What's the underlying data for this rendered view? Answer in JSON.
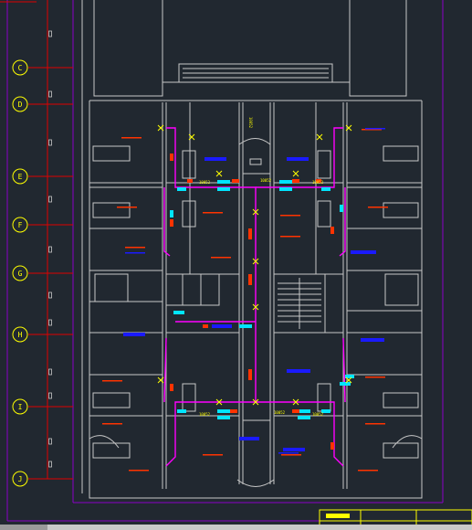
{
  "axis_labels": [
    "C",
    "D",
    "E",
    "F",
    "G",
    "H",
    "I",
    "J"
  ],
  "colors": {
    "background": "#212830",
    "wall": "#c8c8c8",
    "border": "#8a00c8",
    "duct": "#ff00ff",
    "grid_line": "#e00000",
    "label": "#ffff00",
    "unit_blue": "#1a1aff",
    "unit_cyan": "#00e5ff",
    "unit_red": "#ff3300"
  },
  "annotations": {
    "corridor_upper_left": "10052",
    "corridor_upper_mid": "10052",
    "corridor_upper_right": "10052",
    "vertical_mid": "10052",
    "corridor_lower_left": "10052",
    "corridor_lower_mid": "10052",
    "corridor_lower_right": "10052"
  },
  "status": {
    "active_tab": "model"
  }
}
